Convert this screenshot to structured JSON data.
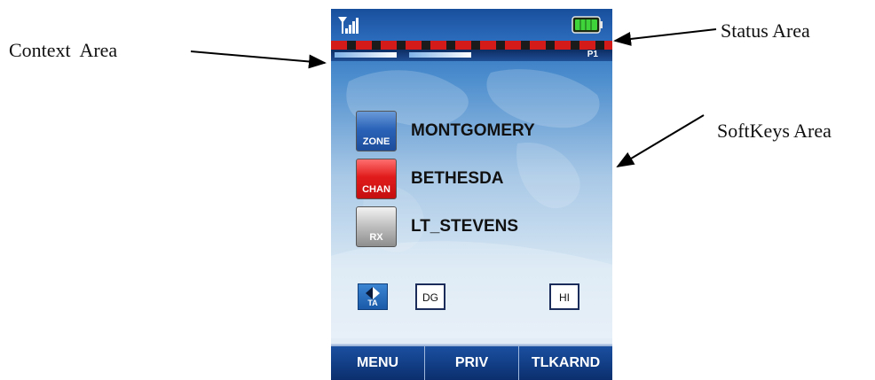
{
  "callouts": {
    "context": "Context  Area",
    "status": "Status Area",
    "softkeys": "SoftKeys Area"
  },
  "status_bar": {
    "signal_icon": "signal-antenna-icon",
    "battery_icon": "battery-full-icon",
    "page_indicator": "P1"
  },
  "rows": [
    {
      "tile_label": "ZONE",
      "name": "MONTGOMERY",
      "color": "#2a63b8"
    },
    {
      "tile_label": "CHAN",
      "name": "BETHESDA",
      "color": "#e11b1b"
    },
    {
      "tile_label": "RX",
      "name": "LT_STEVENS",
      "color": "#9e9e9e"
    }
  ],
  "indicators": {
    "ta_label": "TA",
    "dg_label": "DG",
    "hi_label": "HI"
  },
  "softkeys": [
    "MENU",
    "PRIV",
    "TLKARND"
  ]
}
